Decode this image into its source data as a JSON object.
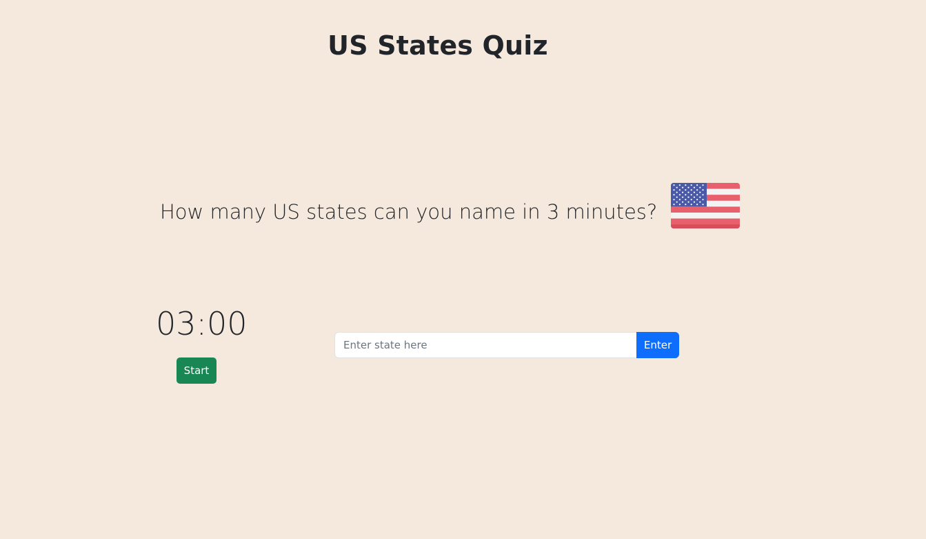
{
  "header": {
    "title": "US States Quiz"
  },
  "prompt": {
    "question": "How many US states can you name in 3 minutes?",
    "flag_icon": "us-flag-icon"
  },
  "timer": {
    "display": "03:00",
    "start_label": "Start",
    "start_color": "#198754"
  },
  "entry": {
    "placeholder": "Enter state here",
    "value": "",
    "submit_label": "Enter",
    "submit_color": "#0d6efd"
  },
  "colors": {
    "background": "#f5e9de",
    "text": "#212529",
    "flag_red": "#e8606b",
    "flag_blue": "#4a5aa8"
  }
}
